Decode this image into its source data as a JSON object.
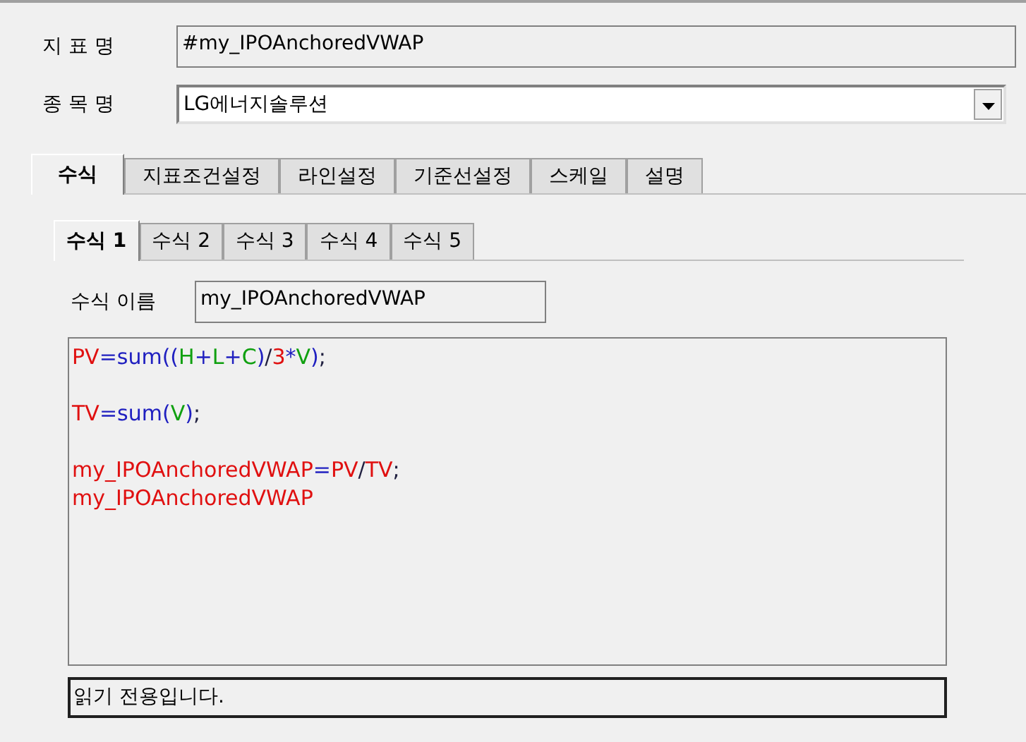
{
  "indicator_name": {
    "label": "지 표 명",
    "value": "#my_IPOAnchoredVWAP"
  },
  "item_name": {
    "label": "종 목 명",
    "value": "LG에너지솔루션"
  },
  "tabs": [
    {
      "label": "수식",
      "selected": true
    },
    {
      "label": "지표조건설정",
      "selected": false
    },
    {
      "label": "라인설정",
      "selected": false
    },
    {
      "label": "기준선설정",
      "selected": false
    },
    {
      "label": "스케일",
      "selected": false
    },
    {
      "label": "설명",
      "selected": false
    }
  ],
  "formula_tabs": [
    {
      "label": "수식 1",
      "selected": true
    },
    {
      "label": "수식 2",
      "selected": false
    },
    {
      "label": "수식 3",
      "selected": false
    },
    {
      "label": "수식 4",
      "selected": false
    },
    {
      "label": "수식 5",
      "selected": false
    }
  ],
  "formula_name": {
    "label": "수식 이름",
    "value": "my_IPOAnchoredVWAP"
  },
  "code_lines": [
    {
      "kind": "code",
      "tokens": [
        {
          "kind": "var",
          "text": "PV"
        },
        {
          "kind": "op",
          "text": "="
        },
        {
          "kind": "func",
          "text": "sum(("
        },
        {
          "kind": "field",
          "text": "H"
        },
        {
          "kind": "op",
          "text": "+"
        },
        {
          "kind": "field",
          "text": "L"
        },
        {
          "kind": "op",
          "text": "+"
        },
        {
          "kind": "field",
          "text": "C"
        },
        {
          "kind": "func",
          "text": ")"
        },
        {
          "kind": "punct",
          "text": "/"
        },
        {
          "kind": "var",
          "text": "3"
        },
        {
          "kind": "op",
          "text": "*"
        },
        {
          "kind": "field",
          "text": "V"
        },
        {
          "kind": "func",
          "text": ")"
        },
        {
          "kind": "punct",
          "text": ";"
        }
      ]
    },
    {
      "kind": "blank"
    },
    {
      "kind": "code",
      "tokens": [
        {
          "kind": "var",
          "text": "TV"
        },
        {
          "kind": "op",
          "text": "="
        },
        {
          "kind": "func",
          "text": "sum("
        },
        {
          "kind": "field",
          "text": "V"
        },
        {
          "kind": "func",
          "text": ")"
        },
        {
          "kind": "punct",
          "text": ";"
        }
      ]
    },
    {
      "kind": "blank"
    },
    {
      "kind": "code",
      "tokens": [
        {
          "kind": "var",
          "text": "my_IPOAnchoredVWAP"
        },
        {
          "kind": "op",
          "text": "="
        },
        {
          "kind": "var",
          "text": "PV"
        },
        {
          "kind": "punct",
          "text": "/"
        },
        {
          "kind": "var",
          "text": "TV"
        },
        {
          "kind": "punct",
          "text": ";"
        }
      ]
    },
    {
      "kind": "code",
      "tokens": [
        {
          "kind": "var",
          "text": "my_IPOAnchoredVWAP"
        }
      ]
    }
  ],
  "status": "읽기 전용입니다."
}
